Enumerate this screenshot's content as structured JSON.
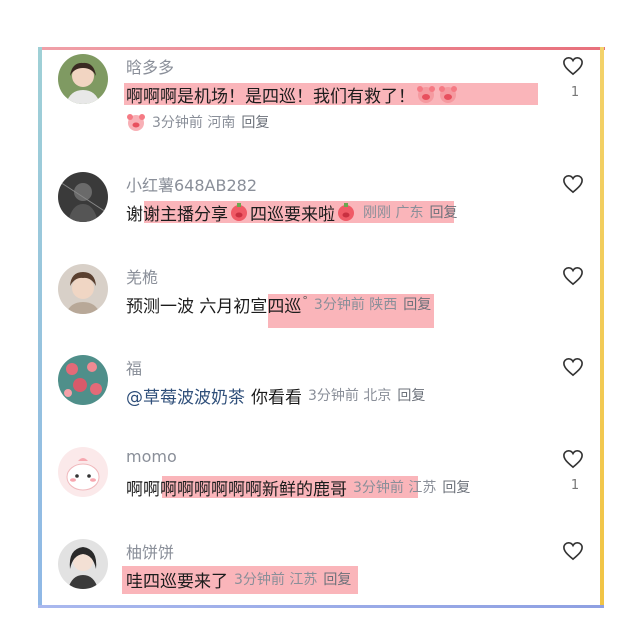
{
  "comments": [
    {
      "name": "晗多多",
      "prefix": "",
      "text": "啊啊啊是机场！是四巡！我们有救了！",
      "meta": "3分钟前 河南",
      "reply": "回复",
      "likes": "1"
    },
    {
      "name": "小红薯648AB282",
      "prefix": "谢",
      "text": "谢主播分享",
      "text2": "四巡要来啦",
      "meta": "刚刚 广东",
      "reply": "回复",
      "likes": ""
    },
    {
      "name": "羌桅",
      "text": "预测一波 六月初宣四巡",
      "meta": "3分钟前 陕西",
      "reply": "回复",
      "likes": ""
    },
    {
      "name": "福",
      "mention": "@草莓波波奶茶",
      "text": "你看看",
      "meta": "3分钟前 北京",
      "reply": "回复",
      "likes": ""
    },
    {
      "name": "momo",
      "prefix": "啊啊",
      "text": "啊啊啊啊啊啊新鲜的鹿哥",
      "meta": "3分钟前 江苏",
      "reply": "回复",
      "likes": "1"
    },
    {
      "name": "柚饼饼",
      "text": "哇四巡要来了",
      "meta": "3分钟前 江苏",
      "reply": "回复",
      "likes": ""
    }
  ],
  "icons": {
    "like": "heart-icon",
    "emoji": "piggy-emoji-icon",
    "location": "location-dot"
  },
  "colors": {
    "highlight": "#f67882",
    "meta_text": "#8a8f99",
    "frame_top": "#e8707c",
    "frame_right": "#f1c444",
    "frame_left": "#9fd0d6",
    "frame_bottom": "#8ea0e2"
  }
}
